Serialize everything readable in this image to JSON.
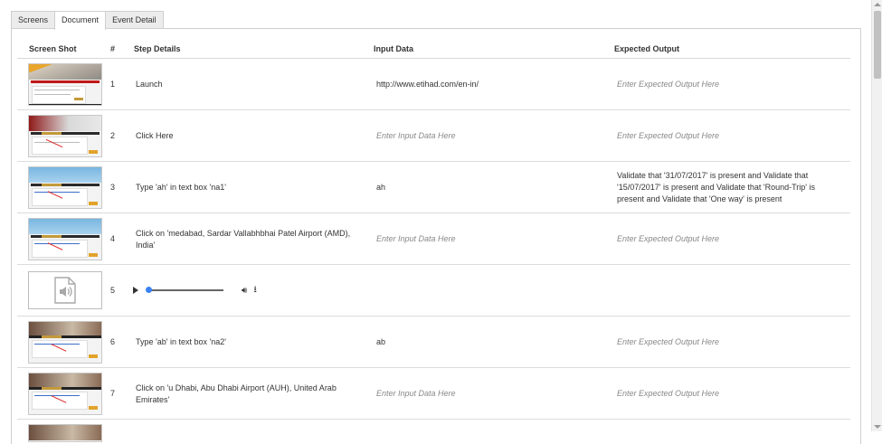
{
  "tabs": [
    {
      "label": "Screens",
      "active": false
    },
    {
      "label": "Document",
      "active": true
    },
    {
      "label": "Event Detail",
      "active": false
    }
  ],
  "columns": {
    "screenshot": "Screen Shot",
    "num": "#",
    "step": "Step Details",
    "input": "Input Data",
    "output": "Expected Output"
  },
  "rows": [
    {
      "num": "1",
      "step": "Launch",
      "input": "http://www.etihad.com/en-in/",
      "input_placeholder": false,
      "output": "Enter Expected Output Here",
      "output_placeholder": true
    },
    {
      "num": "2",
      "step": "Click Here",
      "input": "Enter Input Data Here",
      "input_placeholder": true,
      "output": "Enter Expected Output Here",
      "output_placeholder": true
    },
    {
      "num": "3",
      "step": "Type 'ah' in text box 'na1'",
      "input": "ah",
      "input_placeholder": false,
      "output": "Validate that '31/07/2017' is present and Validate that '15/07/2017' is present and Validate that 'Round-Trip' is present and Validate that 'One way' is present",
      "output_placeholder": false
    },
    {
      "num": "4",
      "step": "Click on 'medabad, Sardar Vallabhbhai Patel Airport (AMD), India'",
      "input": "Enter Input Data Here",
      "input_placeholder": true,
      "output": "Enter Expected Output Here",
      "output_placeholder": true
    },
    {
      "num": "5",
      "step": "",
      "input": "",
      "input_placeholder": false,
      "output": "",
      "output_placeholder": false
    },
    {
      "num": "6",
      "step": "Type 'ab' in text box 'na2'",
      "input": "ab",
      "input_placeholder": false,
      "output": "Enter Expected Output Here",
      "output_placeholder": true
    },
    {
      "num": "7",
      "step": "Click on 'u Dhabi, Abu Dhabi Airport (AUH), United Arab Emirates'",
      "input": "Enter Input Data Here",
      "input_placeholder": true,
      "output": "Enter Expected Output Here",
      "output_placeholder": true
    }
  ],
  "audio": {
    "play_icon": "play-icon",
    "volume_icon": "volume-icon",
    "download_icon": "download-icon",
    "progress": 0
  },
  "colors": {
    "accent": "#3b82f6",
    "placeholder": "#888888",
    "border": "#dcdcdc"
  }
}
